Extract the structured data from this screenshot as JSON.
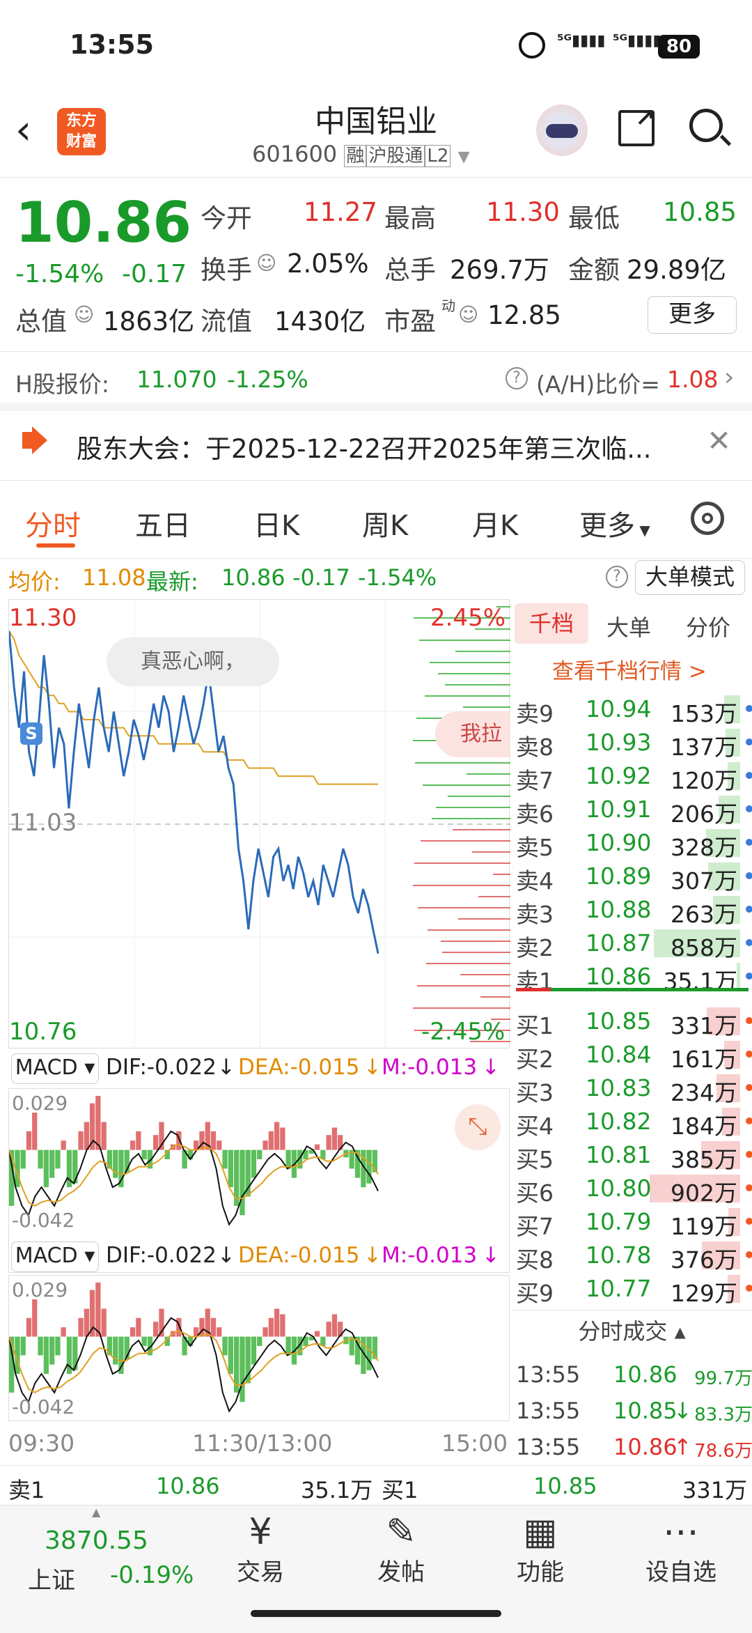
{
  "status": {
    "time": "13:55",
    "battery": "80"
  },
  "header": {
    "title": "中国铝业",
    "code": "601600",
    "badges": [
      "融",
      "沪股通",
      "L2"
    ],
    "logo_top": "东方",
    "logo_bottom": "财富"
  },
  "quote": {
    "price": "10.86",
    "pct": "-1.54%",
    "chg": "-0.17",
    "open_label": "今开",
    "open": "11.27",
    "high_label": "最高",
    "high": "11.30",
    "low_label": "最低",
    "low": "10.85",
    "turnover_label": "换手",
    "turnover": "2.05%",
    "vol_label": "总手",
    "vol": "269.7万",
    "amount_label": "金额",
    "amount": "29.89亿",
    "mcap_label": "总值",
    "mcap": "1863亿",
    "float_label": "流值",
    "float": "1430亿",
    "pe_label": "市盈",
    "pe_sup": "动",
    "pe": "12.85",
    "more": "更多"
  },
  "hshare": {
    "label": "H股报价:",
    "price": "11.070",
    "pct": "-1.25%",
    "ratio_label": "(A/H)比价=",
    "ratio": "1.08"
  },
  "notice": {
    "text": "股东大会：于2025-12-22召开2025年第三次临..."
  },
  "tabs": [
    "分时",
    "五日",
    "日K",
    "周K",
    "月K",
    "更多"
  ],
  "maininfo": {
    "avg_label": "均价:",
    "avg": "11.08",
    "last_label": "最新:",
    "last": "10.86",
    "chg": "-0.17",
    "pct": "-1.54%",
    "mode": "大单模式"
  },
  "chart": {
    "ymax": "11.30",
    "ymid": "11.03",
    "ymin": "10.76",
    "pmax": "2.45%",
    "pmin": "-2.45%",
    "bubble1": "真恶心啊，",
    "bubble2": "我拉",
    "s_marker": "S",
    "times": [
      "09:30",
      "11:30/13:00",
      "15:00"
    ],
    "price": [
      11.27,
      11.2,
      11.15,
      11.22,
      11.12,
      11.09,
      11.16,
      11.24,
      11.18,
      11.1,
      11.15,
      11.13,
      11.05,
      11.12,
      11.18,
      11.14,
      11.1,
      11.16,
      11.2,
      11.15,
      11.12,
      11.17,
      11.13,
      11.09,
      11.12,
      11.16,
      11.14,
      11.11,
      11.14,
      11.18,
      11.15,
      11.19,
      11.17,
      11.12,
      11.15,
      11.19,
      11.16,
      11.13,
      11.15,
      11.18,
      11.22,
      11.17,
      11.12,
      11.14,
      11.1,
      11.08,
      11.0,
      10.96,
      10.9,
      10.96,
      11.0,
      10.97,
      10.94,
      10.99,
      11.0,
      10.96,
      10.98,
      10.95,
      10.99,
      10.97,
      10.94,
      10.96,
      10.93,
      10.98,
      10.96,
      10.94,
      10.97,
      11.0,
      10.98,
      10.94,
      10.92,
      10.95,
      10.93,
      10.9,
      10.87
    ],
    "avg": [
      11.27,
      11.26,
      11.24,
      11.23,
      11.22,
      11.21,
      11.2,
      11.2,
      11.19,
      11.19,
      11.18,
      11.18,
      11.17,
      11.17,
      11.17,
      11.16,
      11.16,
      11.16,
      11.16,
      11.15,
      11.15,
      11.15,
      11.15,
      11.15,
      11.14,
      11.14,
      11.14,
      11.14,
      11.14,
      11.14,
      11.13,
      11.13,
      11.13,
      11.13,
      11.13,
      11.13,
      11.13,
      11.13,
      11.13,
      11.12,
      11.12,
      11.12,
      11.12,
      11.12,
      11.11,
      11.11,
      11.11,
      11.11,
      11.1,
      11.1,
      11.1,
      11.1,
      11.1,
      11.1,
      11.09,
      11.09,
      11.09,
      11.09,
      11.09,
      11.09,
      11.09,
      11.09,
      11.08,
      11.08,
      11.08,
      11.08,
      11.08,
      11.08,
      11.08,
      11.08,
      11.08,
      11.08,
      11.08,
      11.08,
      11.08
    ]
  },
  "macd": {
    "label": "MACD",
    "dif": "DIF:-0.022",
    "dea": "DEA:-0.015",
    "m": "M:-0.013",
    "top": "0.029",
    "bottom": "-0.042",
    "hist": [
      -0.03,
      -0.02,
      -0.01,
      0.01,
      0.02,
      -0.01,
      -0.02,
      -0.015,
      -0.01,
      0.005,
      -0.02,
      -0.018,
      0.01,
      0.015,
      0.025,
      0.029,
      0.015,
      -0.01,
      -0.015,
      -0.02,
      -0.012,
      0.005,
      0.01,
      -0.005,
      -0.01,
      0.008,
      0.015,
      -0.005,
      0.003,
      0.01,
      -0.01,
      -0.005,
      0.005,
      0.01,
      0.015,
      0.01,
      0.005,
      -0.01,
      -0.02,
      -0.03,
      -0.035,
      -0.025,
      -0.015,
      -0.005,
      0.005,
      0.01,
      0.015,
      0.012,
      -0.01,
      -0.015,
      -0.01,
      -0.005,
      -0.002,
      0.003,
      -0.005,
      0.008,
      0.012,
      0.008,
      -0.004,
      -0.01,
      -0.015,
      -0.02,
      -0.018,
      -0.012
    ],
    "difline": [
      0,
      -0.02,
      -0.03,
      -0.035,
      -0.025,
      -0.02,
      -0.025,
      -0.03,
      -0.022,
      -0.015,
      -0.018,
      -0.01,
      0.0,
      0.005,
      0.002,
      -0.01,
      -0.02,
      -0.018,
      -0.012,
      -0.005,
      -0.002,
      -0.008,
      -0.005,
      0.0,
      0.005,
      0.01,
      0.008,
      0.0,
      -0.005,
      0.0,
      0.004,
      0.002,
      -0.01,
      -0.03,
      -0.04,
      -0.035,
      -0.025,
      -0.02,
      -0.015,
      -0.01,
      -0.005,
      -0.002,
      -0.005,
      -0.01,
      -0.008,
      -0.004,
      0.002,
      0.0,
      -0.006,
      -0.01,
      -0.005,
      0.0,
      0.004,
      0.002,
      -0.005,
      -0.01,
      -0.015,
      -0.022
    ],
    "dealine": [
      0,
      -0.01,
      -0.02,
      -0.028,
      -0.03,
      -0.028,
      -0.027,
      -0.028,
      -0.027,
      -0.024,
      -0.022,
      -0.019,
      -0.014,
      -0.009,
      -0.006,
      -0.007,
      -0.011,
      -0.013,
      -0.013,
      -0.011,
      -0.009,
      -0.009,
      -0.008,
      -0.006,
      -0.003,
      0.001,
      0.003,
      0.002,
      0.0,
      0.0,
      0.001,
      0.001,
      -0.002,
      -0.01,
      -0.02,
      -0.026,
      -0.026,
      -0.024,
      -0.021,
      -0.018,
      -0.014,
      -0.011,
      -0.009,
      -0.009,
      -0.009,
      -0.008,
      -0.005,
      -0.004,
      -0.004,
      -0.006,
      -0.006,
      -0.004,
      -0.002,
      -0.001,
      -0.002,
      -0.005,
      -0.008,
      -0.013
    ]
  },
  "book": {
    "tabs": [
      "千档",
      "大单",
      "分价"
    ],
    "link": "查看千档行情 >",
    "asks": [
      {
        "l": "卖9",
        "p": "10.94",
        "v": "153万",
        "w": 0.18
      },
      {
        "l": "卖8",
        "p": "10.93",
        "v": "137万",
        "w": 0.16
      },
      {
        "l": "卖7",
        "p": "10.92",
        "v": "120万",
        "w": 0.14
      },
      {
        "l": "卖6",
        "p": "10.91",
        "v": "206万",
        "w": 0.24
      },
      {
        "l": "卖5",
        "p": "10.90",
        "v": "328万",
        "w": 0.38
      },
      {
        "l": "卖4",
        "p": "10.89",
        "v": "307万",
        "w": 0.35
      },
      {
        "l": "卖3",
        "p": "10.88",
        "v": "263万",
        "w": 0.3
      },
      {
        "l": "卖2",
        "p": "10.87",
        "v": "858万",
        "w": 0.95
      },
      {
        "l": "卖1",
        "p": "10.86",
        "v": "35.1万",
        "w": 0.04
      }
    ],
    "bids": [
      {
        "l": "买1",
        "p": "10.85",
        "v": "331万",
        "w": 0.37
      },
      {
        "l": "买2",
        "p": "10.84",
        "v": "161万",
        "w": 0.18
      },
      {
        "l": "买3",
        "p": "10.83",
        "v": "234万",
        "w": 0.26
      },
      {
        "l": "买4",
        "p": "10.82",
        "v": "184万",
        "w": 0.2
      },
      {
        "l": "买5",
        "p": "10.81",
        "v": "385万",
        "w": 0.43
      },
      {
        "l": "买6",
        "p": "10.80",
        "v": "902万",
        "w": 1.0
      },
      {
        "l": "买7",
        "p": "10.79",
        "v": "119万",
        "w": 0.13
      },
      {
        "l": "买8",
        "p": "10.78",
        "v": "376万",
        "w": 0.42
      },
      {
        "l": "买9",
        "p": "10.77",
        "v": "129万",
        "w": 0.14
      }
    ],
    "trades_title": "分时成交",
    "trades": [
      {
        "t": "13:55",
        "p": "10.86",
        "v": "99.7万",
        "d": "",
        "c": "green"
      },
      {
        "t": "13:55",
        "p": "10.85",
        "v": "83.3万",
        "d": "↓",
        "c": "green"
      },
      {
        "t": "13:55",
        "p": "10.86",
        "v": "78.6万",
        "d": "↑",
        "c": "red"
      }
    ]
  },
  "bottom": {
    "sell_label": "卖1",
    "sell_p": "10.86",
    "sell_v": "35.1万",
    "buy_label": "买1",
    "buy_p": "10.85",
    "buy_v": "331万"
  },
  "nav": {
    "index_val": "3870.55",
    "index_name": "上证",
    "index_pct": "-0.19%",
    "items": [
      "交易",
      "发帖",
      "功能",
      "设自选"
    ]
  }
}
